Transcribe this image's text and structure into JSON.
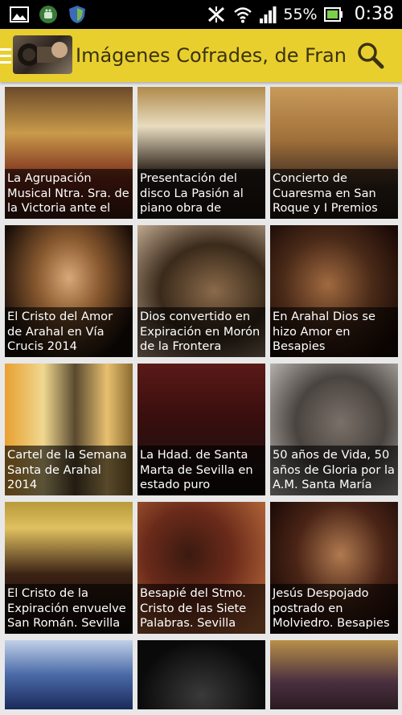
{
  "status_bar": {
    "battery_percent": "55%",
    "time": "0:38",
    "left_icons": [
      "gallery-icon",
      "android-app-icon",
      "shield-icon"
    ],
    "right_icons": [
      "no-sync-icon",
      "wifi-icon",
      "signal-icon",
      "battery-icon"
    ]
  },
  "app_bar": {
    "title": "Imágenes Cofrades, de Fran",
    "color": "#e8cf2e"
  },
  "grid": {
    "items": [
      {
        "caption": "La Agrupación Musical Ntra. Sra. de la Victoria ante el",
        "bg": "linear-gradient(180deg,#6b4a2a 0%,#c99a4a 35%,#7a2a1a 70%,#3a1a10 100%)"
      },
      {
        "caption": "Presentación del disco La Pasión al piano obra de",
        "bg": "linear-gradient(180deg,#b08a4a 0%,#e8dcc0 30%,#2a2018 65%,#1a1410 100%)"
      },
      {
        "caption": "Concierto de Cuaresma en San Roque y I Premios",
        "bg": "linear-gradient(180deg,#c89a5a 0%,#a0703a 40%,#3a2a20 75%,#201810 100%)"
      },
      {
        "caption": "El Cristo del Amor de Arahal en Vía Crucis 2014",
        "bg": "radial-gradient(ellipse at 50% 40%,#d8a878 0%,#8a5a30 35%,#1a0e08 80%)"
      },
      {
        "caption": "Dios convertido en Expiración en Morón de la Frontera",
        "bg": "radial-gradient(ellipse at 60% 50%,#8a6a4a 0%,#3a2a1a 50%,#c0a890 100%)"
      },
      {
        "caption": "En Arahal Dios se hizo Amor en Besapies",
        "bg": "radial-gradient(ellipse at 45% 45%,#a06a40 0%,#4a2a18 45%,#1a0a06 85%)"
      },
      {
        "caption": "Cartel de la Semana Santa de Arahal 2014",
        "bg": "linear-gradient(90deg,#e8a030 0%,#f0d890 30%,#5a4a30 55%,#e8c070 80%,#8a6a30 100%)"
      },
      {
        "caption": "La Hdad. de Santa Marta de Sevilla en estado puro",
        "bg": "linear-gradient(180deg,#5a1a18 0%,#3a0e0e 40%,#201010 80%,#100808 100%)"
      },
      {
        "caption": "50 años de Vida, 50 años de Gloria por la A.M. Santa María",
        "bg": "radial-gradient(ellipse at 55% 45%,#7a7068 0%,#4a4440 45%,#c8c4c0 100%)"
      },
      {
        "caption": "El Cristo de la Expiración envuelve San Román. Sevilla",
        "bg": "linear-gradient(180deg,#b89a3a 0%,#e0c060 20%,#3a2214 55%,#140c08 100%)"
      },
      {
        "caption": "Besapié del Stmo. Cristo de las Siete Palabras. Sevilla",
        "bg": "radial-gradient(ellipse at 40% 40%,#3a1a10 0%,#6a2a1a 40%,#b86a3a 90%)"
      },
      {
        "caption": "Jesús Despojado postrado en Molviedro. Besapies",
        "bg": "radial-gradient(ellipse at 55% 40%,#b07a50 0%,#4a2416 45%,#1a0a06 85%)"
      },
      {
        "caption": "",
        "bg": "linear-gradient(180deg,#c0d0e8 0%,#4a6aa8 50%,#1a2a5a 100%)"
      },
      {
        "caption": "",
        "bg": "radial-gradient(ellipse at 50% 80%,#3a3a3a 0%,#0a0a0a 70%)"
      },
      {
        "caption": "",
        "bg": "linear-gradient(180deg,#b89048 0%,#4a3040 60%,#2a1a20 100%)"
      }
    ]
  }
}
